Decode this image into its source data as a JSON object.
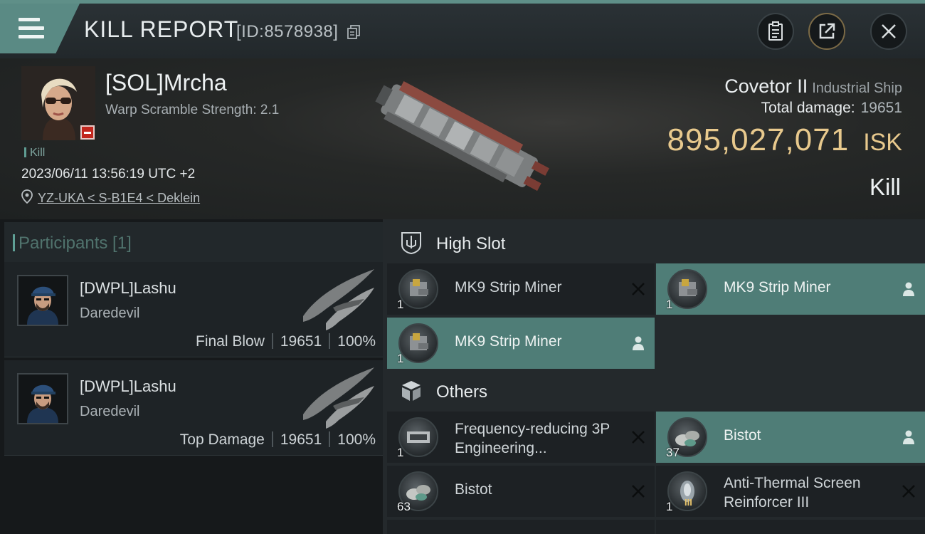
{
  "header": {
    "title": "KILL REPORT",
    "report_id": "[ID:8578938]"
  },
  "victim": {
    "name": "[SOL]Mrcha",
    "warp_scramble": "Warp Scramble Strength: 2.1",
    "kill_tag": "Kill",
    "datetime": "2023/06/11 13:56:19 UTC +2",
    "location": "YZ-UKA < S-B1E4 < Deklein"
  },
  "ship": {
    "name": "Covetor II",
    "class": "Industrial Ship",
    "damage_label": "Total damage:",
    "damage_value": "19651",
    "isk_value": "895,027,071",
    "isk_unit": "ISK",
    "verdict": "Kill"
  },
  "participants": {
    "title": "Participants [1]",
    "items": [
      {
        "name": "[DWPL]Lashu",
        "ship": "Daredevil",
        "role": "Final Blow",
        "damage": "19651",
        "percent": "100%"
      },
      {
        "name": "[DWPL]Lashu",
        "ship": "Daredevil",
        "role": "Top Damage",
        "damage": "19651",
        "percent": "100%"
      }
    ]
  },
  "sections": {
    "high_slot": "High Slot",
    "others": "Others"
  },
  "slots": {
    "high": [
      {
        "name": "MK9 Strip Miner",
        "qty": "1",
        "status": "destroyed"
      },
      {
        "name": "MK9 Strip Miner",
        "qty": "1",
        "status": "dropped"
      },
      {
        "name": "MK9 Strip Miner",
        "qty": "1",
        "status": "dropped"
      }
    ],
    "others": [
      {
        "name": "Frequency-reducing 3P Engineering...",
        "qty": "1",
        "status": "destroyed"
      },
      {
        "name": "Bistot",
        "qty": "37",
        "status": "dropped"
      },
      {
        "name": "Bistot",
        "qty": "63",
        "status": "destroyed"
      },
      {
        "name": "Anti-Thermal Screen Reinforcer III",
        "qty": "1",
        "tier": "III",
        "status": "destroyed"
      }
    ]
  },
  "colors": {
    "accent": "#5a8a84",
    "isk": "#e8c98d",
    "dropped_row": "#4f7d77",
    "destroyed_row": "#1d2124"
  }
}
